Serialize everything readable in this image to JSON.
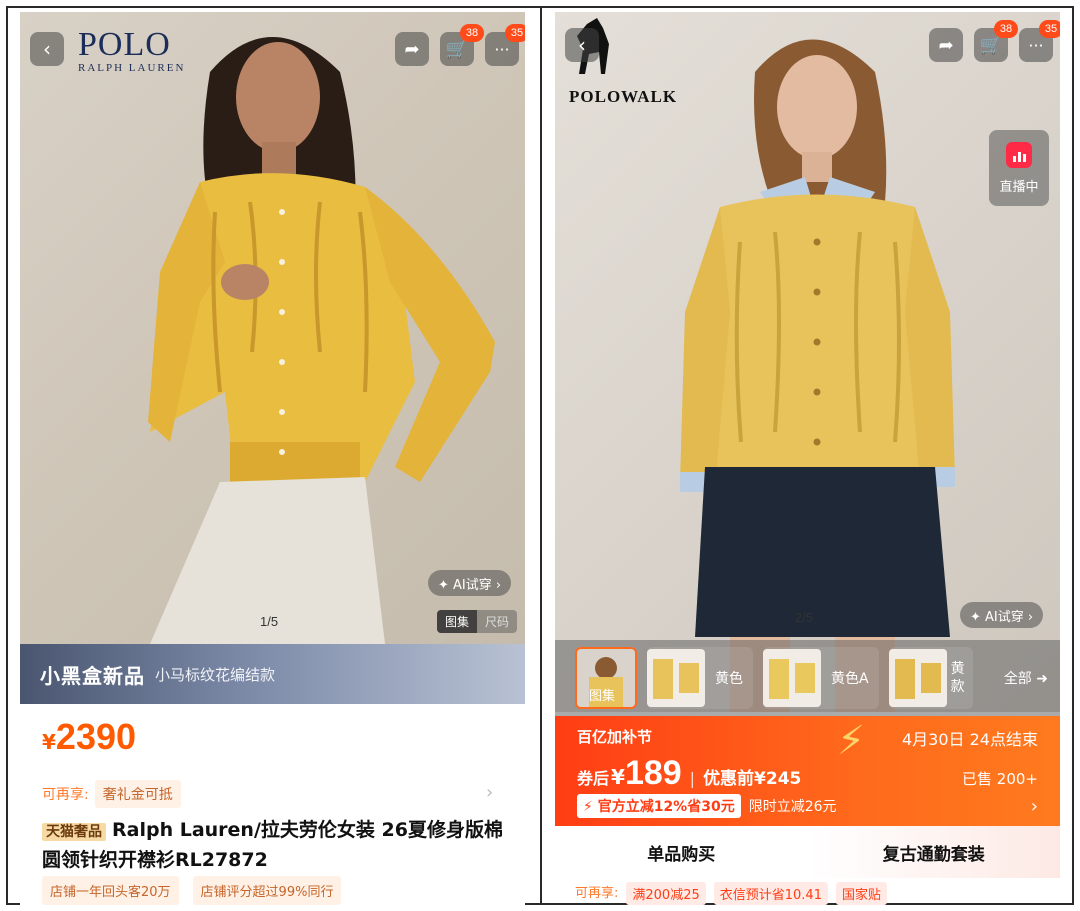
{
  "colors": {
    "price_orange": "#ff5a00",
    "promo_red": "#ff3d14",
    "badge_red": "#ff4a1a",
    "live_red": "#ff2b46",
    "sweater_yellow": "#e9bd3f"
  },
  "left": {
    "brand": {
      "line1": "POLO",
      "line2": "RALPH LAUREN"
    },
    "cart_badge": "38",
    "msg_badge": "35",
    "image_counter": "1/5",
    "ai_tryon": "✦ AI试穿 ›",
    "view_toggle": {
      "gallery": "图集",
      "size": "尺码"
    },
    "black_box": {
      "title": "小黑盒新品",
      "subtitle": "小马标纹花编结款"
    },
    "price": {
      "currency": "¥",
      "value": "2390"
    },
    "enjoy": {
      "label": "可再享:",
      "tag": "奢礼金可抵"
    },
    "title_tag": "天猫奢品",
    "title": "Ralph Lauren/拉夫劳伦女装 26夏修身版棉圆领针织开襟衫RL27872",
    "shop_tags": [
      "店铺一年回头客20万",
      "店铺评分超过99%同行"
    ]
  },
  "right": {
    "brand": "POLOWALK",
    "cart_badge": "38",
    "msg_badge": "35",
    "live_label": "直播中",
    "image_counter": "2/5",
    "ai_tryon": "✦ AI试穿 ›",
    "thumbnails": [
      {
        "label": "图集"
      },
      {
        "label": "黄色"
      },
      {
        "label": "黄色A"
      },
      {
        "label": "黄款"
      }
    ],
    "all_label": "全部",
    "promo": {
      "festival": "百亿加补节",
      "ends": "4月30日 24点结束",
      "after_label": "券后",
      "currency": "¥",
      "after_price": "189",
      "before_text": "优惠前¥245",
      "sold": "已售 200+",
      "official_off": "⚡ 官方立减12%省30元",
      "limited": "限时立减26元"
    },
    "tabs": [
      "单品购买",
      "复古通勤套装"
    ],
    "coupon_row": {
      "label": "可再享:",
      "c1": "满200减25",
      "c2": "衣信预计省10.41",
      "c3": "国家贴"
    }
  }
}
